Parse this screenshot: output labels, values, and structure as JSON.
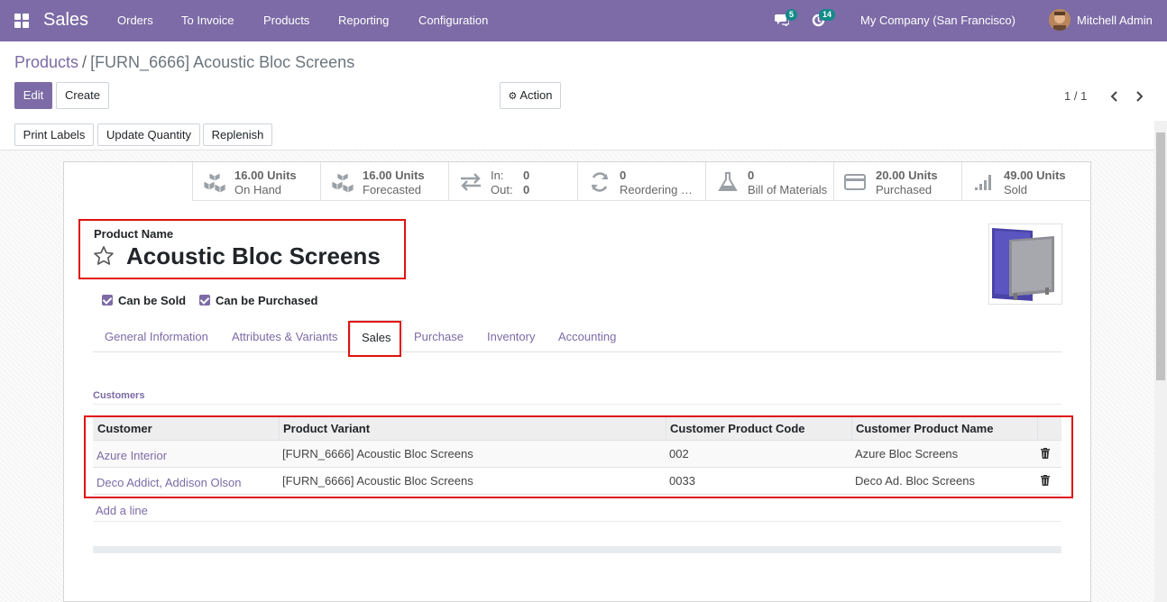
{
  "navbar": {
    "app_name": "Sales",
    "menu": [
      "Orders",
      "To Invoice",
      "Products",
      "Reporting",
      "Configuration"
    ],
    "messages_count": "5",
    "activities_count": "14",
    "company": "My Company (San Francisco)",
    "user": "Mitchell Admin",
    "accent_color": "#7c6ba6"
  },
  "breadcrumb": {
    "parent": "Products",
    "separator": "/",
    "current": "[FURN_6666] Acoustic Bloc Screens"
  },
  "controls": {
    "edit": "Edit",
    "create": "Create",
    "action": "Action",
    "pager": "1 / 1"
  },
  "status_buttons": [
    "Print Labels",
    "Update Quantity",
    "Replenish"
  ],
  "smart_buttons": [
    {
      "icon": "cubes-icon",
      "value": "16.00 Units",
      "label": "On Hand"
    },
    {
      "icon": "cubes-icon",
      "value": "16.00 Units",
      "label": "Forecasted"
    },
    {
      "icon": "exchange-icon",
      "in_label": "In:",
      "in_value": "0",
      "out_label": "Out:",
      "out_value": "0"
    },
    {
      "icon": "refresh-icon",
      "value": "0",
      "label": "Reordering …"
    },
    {
      "icon": "flask-icon",
      "value": "0",
      "label": "Bill of Materials"
    },
    {
      "icon": "credit-card-icon",
      "value": "20.00 Units",
      "label": "Purchased"
    },
    {
      "icon": "signal-icon",
      "value": "49.00 Units",
      "label": "Sold"
    }
  ],
  "product": {
    "name_label": "Product Name",
    "name": "Acoustic Bloc Screens",
    "can_be_sold": "Can be Sold",
    "can_be_purchased": "Can be Purchased"
  },
  "tabs": [
    "General Information",
    "Attributes & Variants",
    "Sales",
    "Purchase",
    "Inventory",
    "Accounting"
  ],
  "active_tab": "Sales",
  "customers": {
    "section_title": "Customers",
    "columns": [
      "Customer",
      "Product Variant",
      "Customer Product Code",
      "Customer Product Name"
    ],
    "rows": [
      {
        "customer": "Azure Interior",
        "variant": "[FURN_6666] Acoustic Bloc Screens",
        "code": "002",
        "name": "Azure Bloc Screens"
      },
      {
        "customer": "Deco Addict, Addison Olson",
        "variant": "[FURN_6666] Acoustic Bloc Screens",
        "code": "0033",
        "name": "Deco Ad. Bloc Screens"
      }
    ],
    "add_line": "Add a line"
  }
}
